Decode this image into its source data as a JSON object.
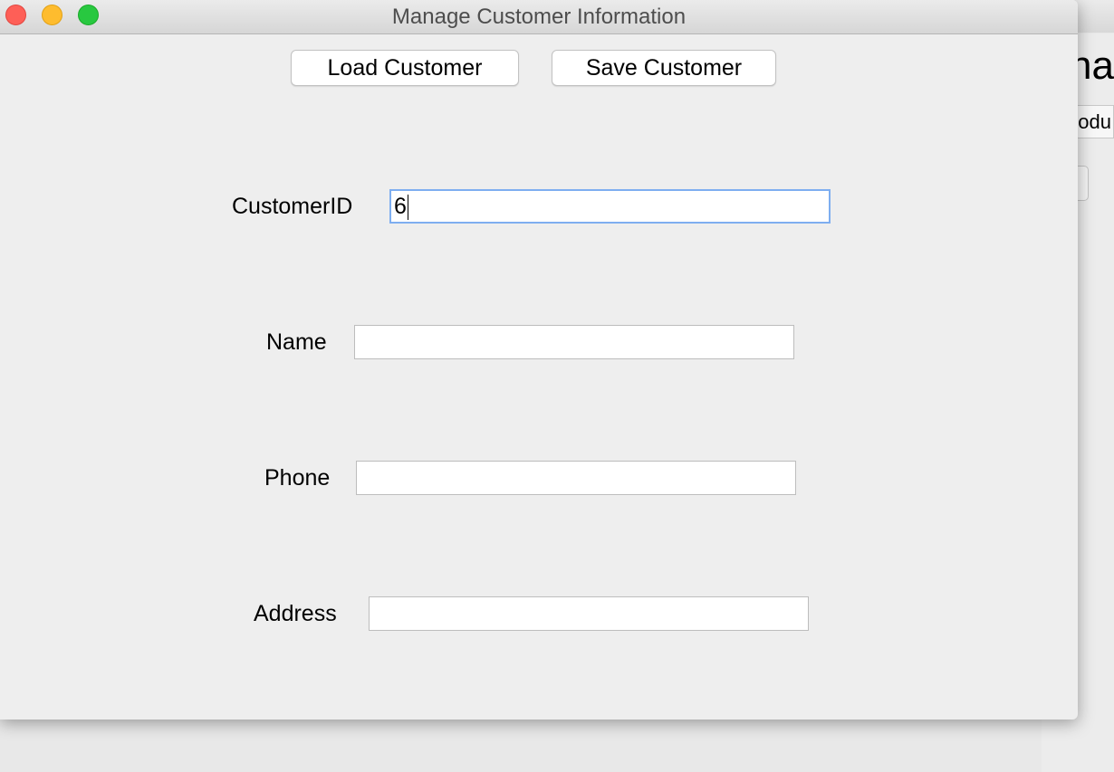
{
  "window": {
    "title": "Manage Customer Information"
  },
  "toolbar": {
    "load_label": "Load Customer",
    "save_label": "Save Customer"
  },
  "form": {
    "customer_id": {
      "label": "CustomerID",
      "value": "6"
    },
    "name": {
      "label": "Name",
      "value": ""
    },
    "phone": {
      "label": "Phone",
      "value": ""
    },
    "address": {
      "label": "Address",
      "value": ""
    }
  },
  "background_window": {
    "heading_fragment": "na",
    "tab_fragment": "odu"
  },
  "colors": {
    "close": "#fe5f57",
    "minimize": "#febc2e",
    "zoom": "#28c840",
    "focus_ring": "#7eaef0"
  }
}
